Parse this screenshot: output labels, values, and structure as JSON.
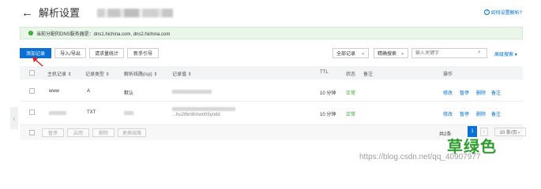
{
  "header": {
    "back_icon": "←",
    "title": "解析设置",
    "help_label": "如何设置解析?",
    "help_icon": "?"
  },
  "notice": {
    "icon": "✓",
    "text": "当前分配的DNS服务器是：dns1.hichina.com, dns2.hichina.com"
  },
  "toolbar": {
    "add_record": "添加记录",
    "import_export": "导入/导出",
    "request_stats": "请求量统计",
    "guide": "新手引导",
    "all_records": "全部记录",
    "exact_search": "精确搜索",
    "search_placeholder": "输入关键字",
    "advanced_search": "高级搜索",
    "chevron": "⌄",
    "search_icon": "⌕",
    "adv_chevron": "▾"
  },
  "table": {
    "headers": {
      "host": "主机记录",
      "type": "记录类型",
      "line": "解析线路(isp)",
      "value": "记录值",
      "ttl": "TTL",
      "status": "状态",
      "remark": "备注",
      "ops": "操作"
    },
    "sort_icon": "⇕",
    "rows": [
      {
        "host": "www",
        "type": "A",
        "line": "默认",
        "value_extra": "",
        "ttl": "10 分钟",
        "status": "正常",
        "op_edit": "修改",
        "op_pause": "暂停",
        "op_delete": "删除",
        "op_remark": "备注"
      },
      {
        "host": "",
        "type": "TXT",
        "line": "",
        "value_extra": "...hu2t6m8mwnh5yndd",
        "ttl": "10 分钟",
        "status": "正常",
        "op_edit": "修改",
        "op_pause": "暂停",
        "op_delete": "删除",
        "op_remark": "备注"
      }
    ]
  },
  "footer": {
    "pause": "暂停",
    "enable": "启用",
    "delete": "删除",
    "change_line": "更换线路",
    "total": "共2条",
    "page": "1",
    "next": "›",
    "page_size": "10 条/页",
    "page_size_chevron": "⌄"
  },
  "side_handle": "‹",
  "watermark": {
    "cn": "草绿色",
    "url": "https://blog.csdn.net/qq_40907977"
  },
  "colors": {
    "primary": "#0a70d4",
    "success": "#2fa52f",
    "annotation_arrow": "#e02020"
  }
}
